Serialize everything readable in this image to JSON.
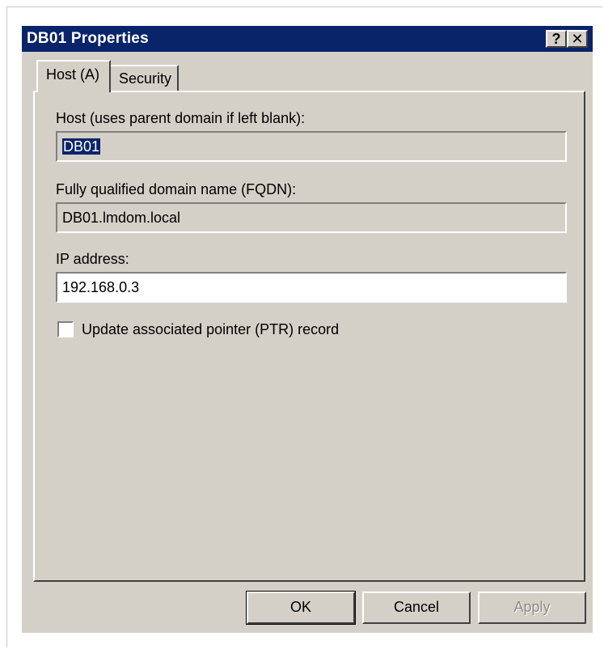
{
  "window": {
    "title": "DB01 Properties",
    "help_glyph": "?",
    "close_glyph": "✕"
  },
  "tabs": [
    {
      "label": "Host (A)",
      "selected": true
    },
    {
      "label": "Security",
      "selected": false
    }
  ],
  "form": {
    "host_label": "Host (uses parent domain if left blank):",
    "host_value": "DB01",
    "fqdn_label": "Fully qualified domain name (FQDN):",
    "fqdn_value": "DB01.lmdom.local",
    "ip_label": "IP address:",
    "ip_value": "192.168.0.3",
    "ptr_label": "Update associated pointer (PTR) record",
    "ptr_checked": false
  },
  "buttons": {
    "ok": "OK",
    "cancel": "Cancel",
    "apply": "Apply"
  },
  "colors": {
    "titlebar": "#0a246a",
    "face": "#d4d0c8",
    "selection": "#0a246a"
  }
}
